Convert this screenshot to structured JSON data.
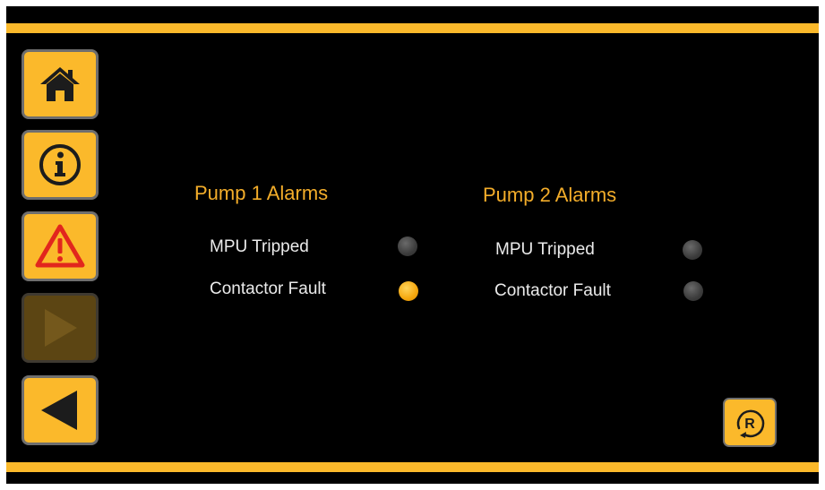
{
  "colors": {
    "accent": "#fbb92b",
    "title": "#f3ad2a",
    "led_off": "#444444",
    "led_on": "#f5a70e",
    "background": "#000000"
  },
  "nav": {
    "items": [
      {
        "icon": "home-icon",
        "state": "enabled"
      },
      {
        "icon": "info-icon",
        "state": "enabled"
      },
      {
        "icon": "warning-icon",
        "state": "enabled"
      },
      {
        "icon": "play-icon",
        "state": "disabled"
      },
      {
        "icon": "back-arrow-icon",
        "state": "enabled"
      }
    ]
  },
  "pump1": {
    "title": "Pump 1 Alarms",
    "alarms": [
      {
        "label": "MPU Tripped",
        "active": false
      },
      {
        "label": "Contactor Fault",
        "active": true
      }
    ]
  },
  "pump2": {
    "title": "Pump 2 Alarms",
    "alarms": [
      {
        "label": "MPU Tripped",
        "active": false
      },
      {
        "label": "Contactor Fault",
        "active": false
      }
    ]
  },
  "reset": {
    "icon": "reset-icon",
    "glyph": "R"
  }
}
